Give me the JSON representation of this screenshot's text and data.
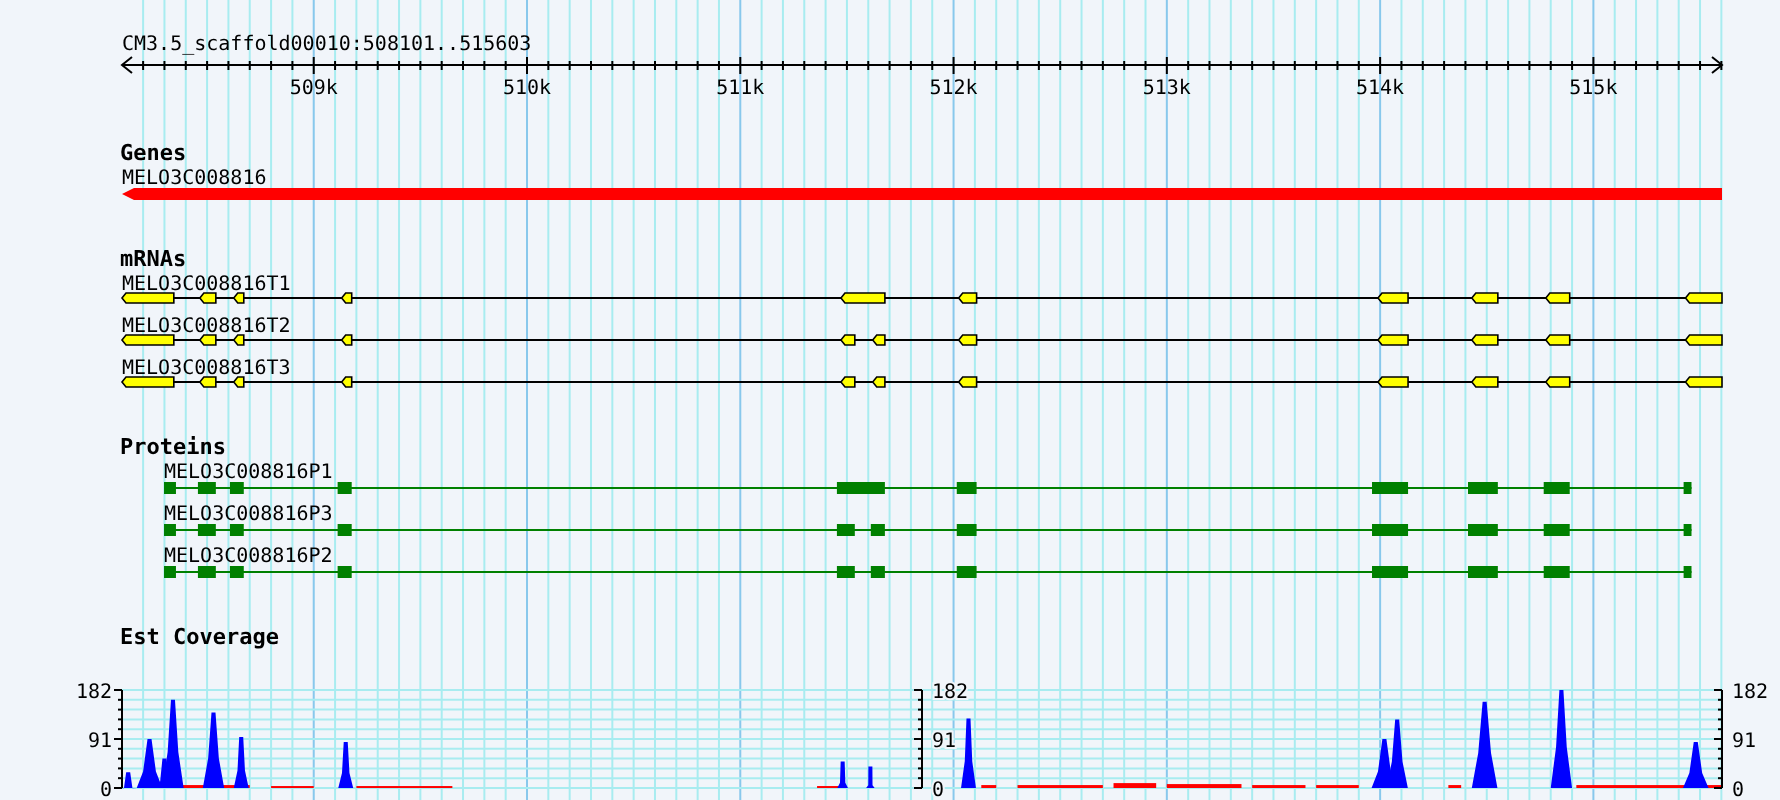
{
  "ruler": {
    "title": "CM3.5_scaffold00010:508101..515603",
    "ticks": [
      "509k",
      "510k",
      "511k",
      "512k",
      "513k",
      "514k",
      "515k"
    ]
  },
  "tracks": [
    {
      "kind": "gene",
      "heading": "Genes",
      "features": [
        {
          "label": "MELO3C008816"
        }
      ]
    },
    {
      "kind": "mrna",
      "heading": "mRNAs",
      "features": [
        {
          "label": "MELO3C008816T1"
        },
        {
          "label": "MELO3C008816T2"
        },
        {
          "label": "MELO3C008816T3"
        }
      ]
    },
    {
      "kind": "protein",
      "heading": "Proteins",
      "features": [
        {
          "label": "MELO3C008816P1"
        },
        {
          "label": "MELO3C008816P3"
        },
        {
          "label": "MELO3C008816P2"
        }
      ]
    },
    {
      "kind": "coverage",
      "heading": "Est Coverage",
      "y_axes": [
        {
          "labels": [
            "182",
            "91",
            "0"
          ]
        },
        {
          "labels": [
            "182",
            "91",
            "0"
          ]
        },
        {
          "labels": [
            "182",
            "91",
            "0"
          ]
        }
      ]
    }
  ]
}
